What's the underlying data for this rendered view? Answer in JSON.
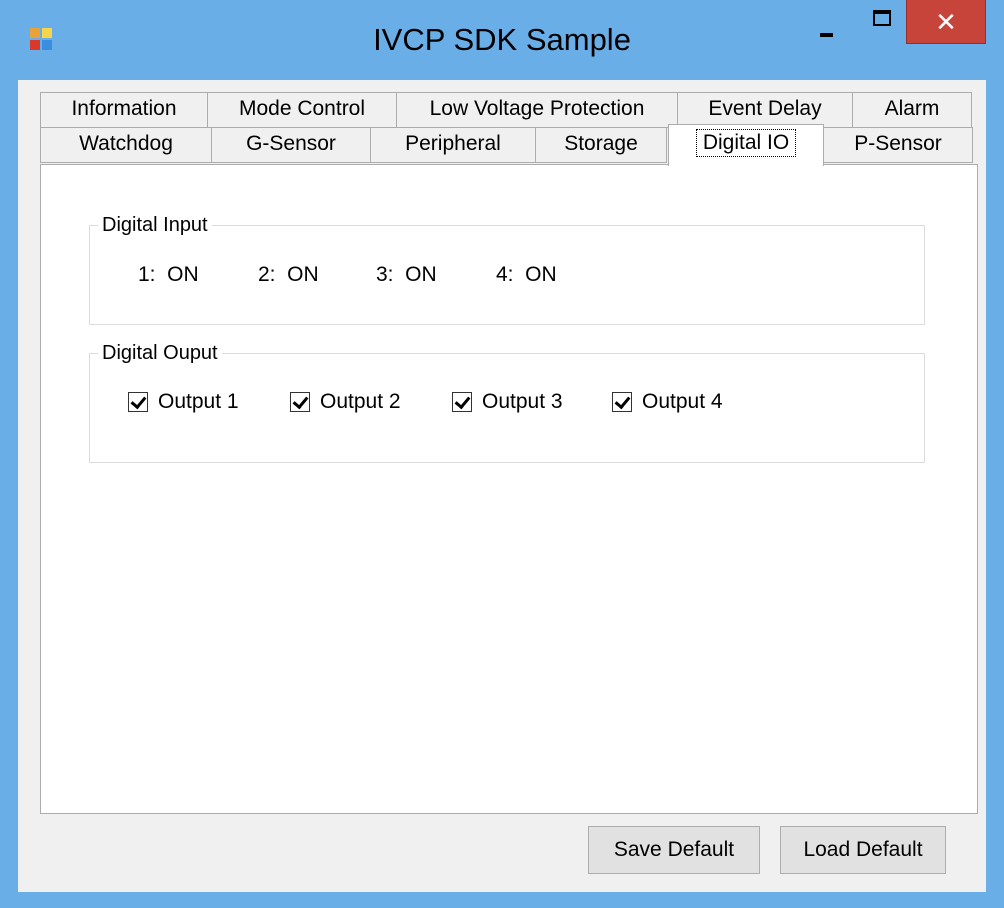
{
  "window": {
    "title": "IVCP SDK Sample",
    "close_glyph": "✕",
    "icon": "app-icon"
  },
  "tabs": {
    "row1": [
      "Information",
      "Mode Control",
      "Low Voltage Protection",
      "Event Delay",
      "Alarm"
    ],
    "row2": [
      "Watchdog",
      "G-Sensor",
      "Peripheral",
      "Storage",
      "Digital IO",
      "P-Sensor"
    ],
    "active": "Digital IO"
  },
  "digital_input": {
    "title": "Digital Input",
    "items": [
      "1:  ON",
      "2:  ON",
      "3:  ON",
      "4:  ON"
    ]
  },
  "digital_output": {
    "title": "Digital Ouput",
    "items": [
      {
        "label": "Output 1",
        "checked": true
      },
      {
        "label": "Output 2",
        "checked": true
      },
      {
        "label": "Output 3",
        "checked": true
      },
      {
        "label": "Output 4",
        "checked": true
      }
    ]
  },
  "buttons": {
    "save_default": "Save Default",
    "load_default": "Load Default"
  },
  "colors": {
    "titlebar": "#6aaee8",
    "close_button": "#c7443a",
    "dialog_bg": "#f0f0f0",
    "tab_page_bg": "#ffffff"
  }
}
